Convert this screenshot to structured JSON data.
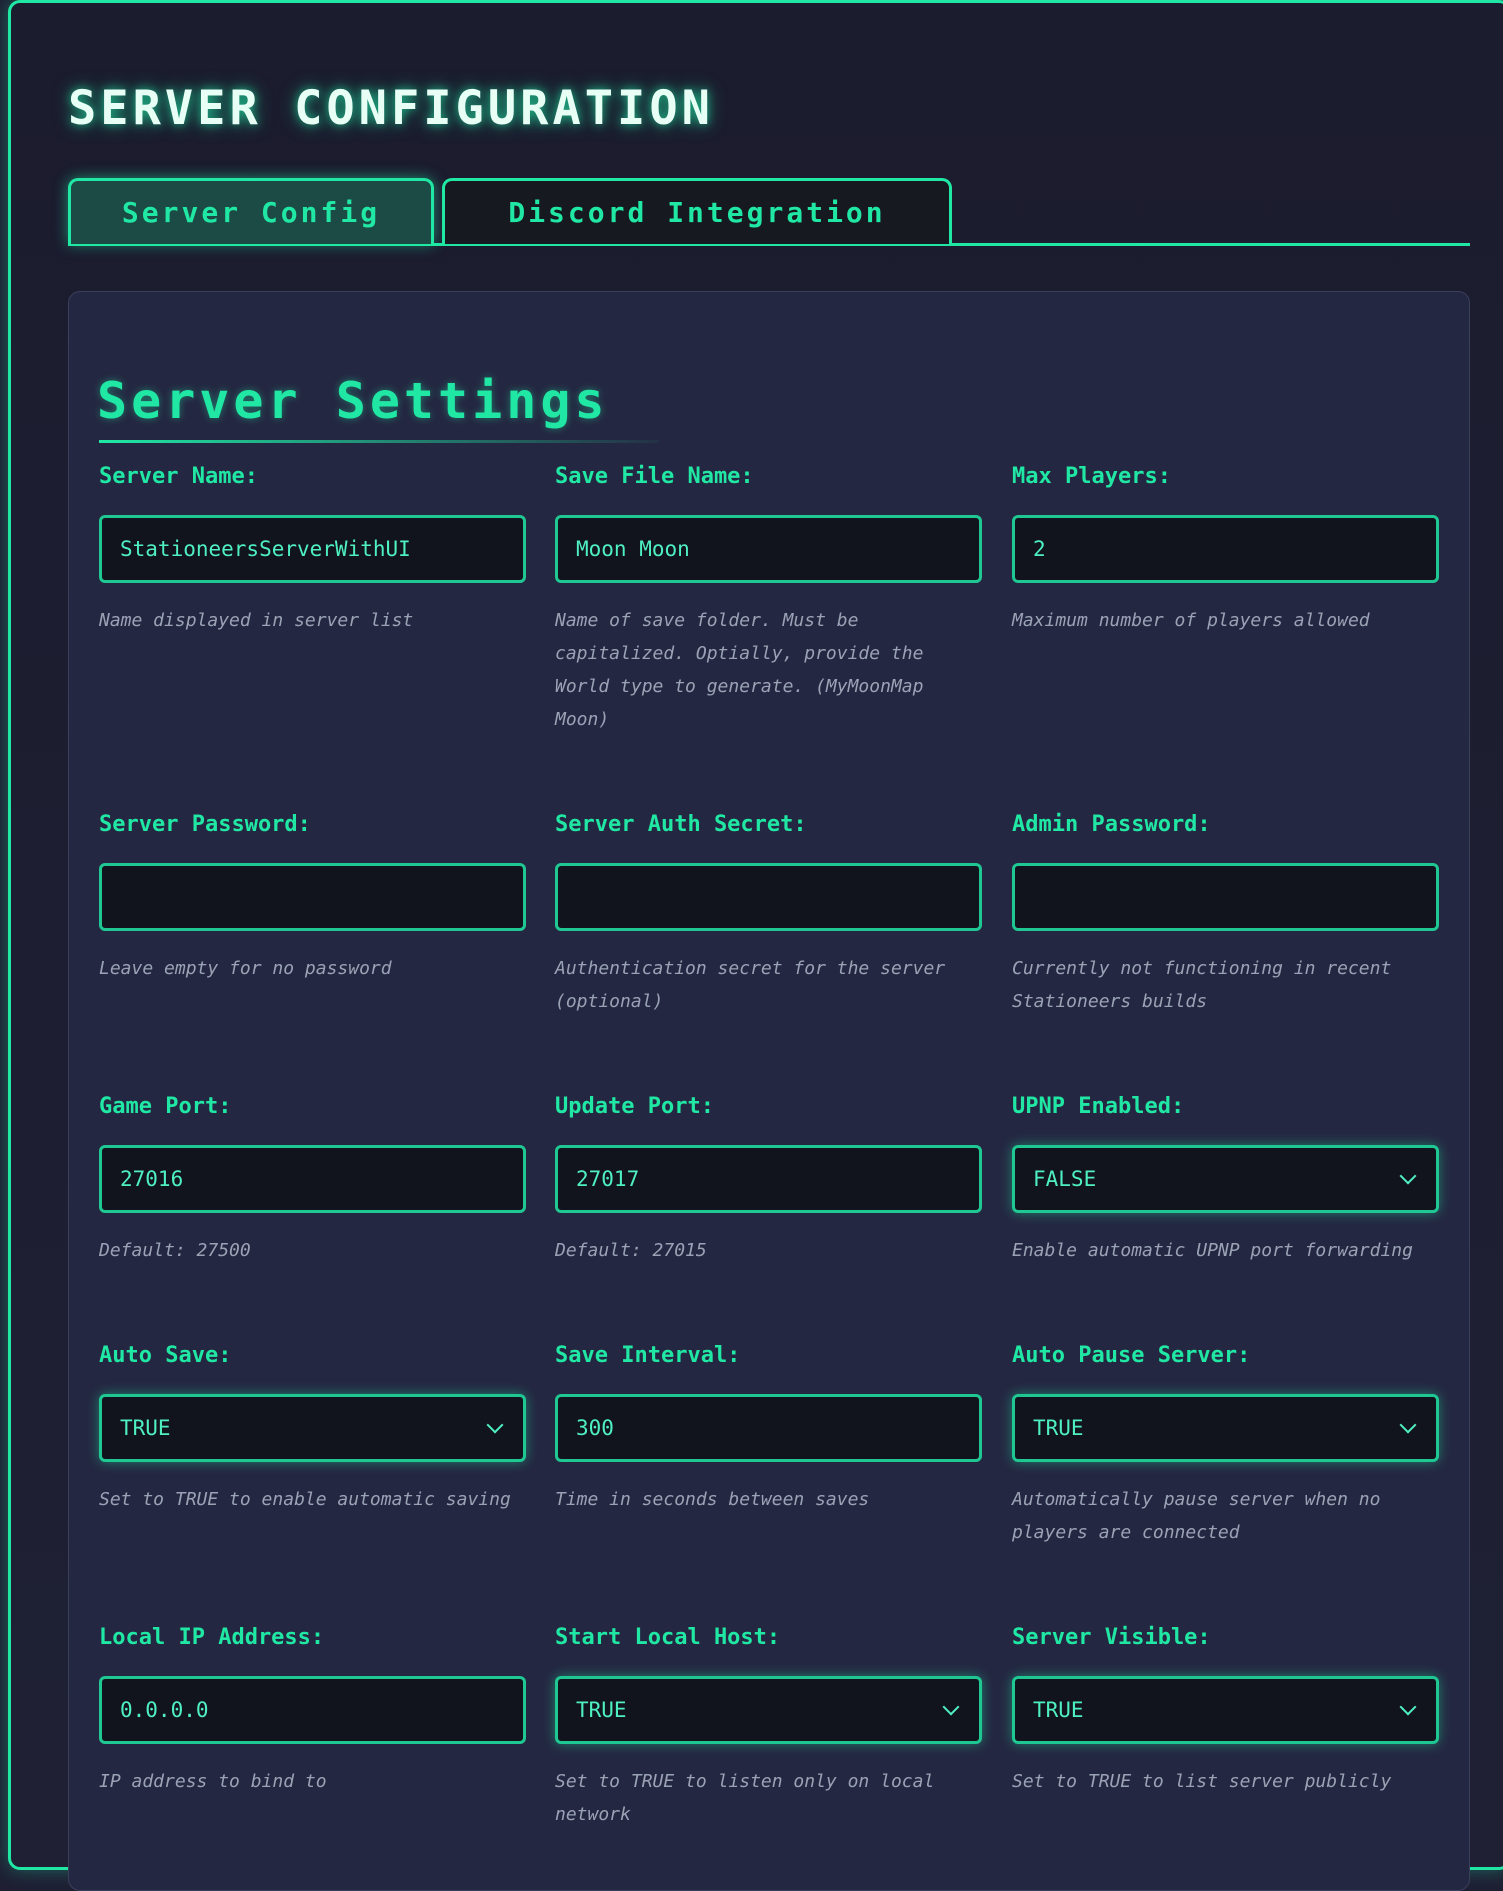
{
  "page_title": "SERVER CONFIGURATION",
  "tabs": [
    {
      "label": "Server Config",
      "active": true
    },
    {
      "label": "Discord Integration",
      "active": false
    }
  ],
  "section_title": "Server Settings",
  "accent_color": "#20e8a4",
  "fields": {
    "server_name": {
      "label": "Server Name:",
      "value": "StationeersServerWithUI",
      "help": "Name displayed in server list"
    },
    "save_file_name": {
      "label": "Save File Name:",
      "value": "Moon Moon",
      "help": "Name of save folder. Must be capitalized. Optially, provide the World type to generate. (MyMoonMap Moon)"
    },
    "max_players": {
      "label": "Max Players:",
      "value": "2",
      "help": "Maximum number of players allowed"
    },
    "server_password": {
      "label": "Server Password:",
      "value": "",
      "help": "Leave empty for no password"
    },
    "server_auth_secret": {
      "label": "Server Auth Secret:",
      "value": "",
      "help": "Authentication secret for the server (optional)"
    },
    "admin_password": {
      "label": "Admin Password:",
      "value": "",
      "help": "Currently not functioning in recent Stationeers builds"
    },
    "game_port": {
      "label": "Game Port:",
      "value": "27016",
      "help": "Default: 27500"
    },
    "update_port": {
      "label": "Update Port:",
      "value": "27017",
      "help": "Default: 27015"
    },
    "upnp_enabled": {
      "label": "UPNP Enabled:",
      "value": "FALSE",
      "help": "Enable automatic UPNP port forwarding"
    },
    "auto_save": {
      "label": "Auto Save:",
      "value": "TRUE",
      "help": "Set to TRUE to enable automatic saving"
    },
    "save_interval": {
      "label": "Save Interval:",
      "value": "300",
      "help": "Time in seconds between saves"
    },
    "auto_pause_server": {
      "label": "Auto Pause Server:",
      "value": "TRUE",
      "help": "Automatically pause server when no players are connected"
    },
    "local_ip_address": {
      "label": "Local IP Address:",
      "value": "0.0.0.0",
      "help": "IP address to bind to"
    },
    "start_local_host": {
      "label": "Start Local Host:",
      "value": "TRUE",
      "help": "Set to TRUE to listen only on local network"
    },
    "server_visible": {
      "label": "Server Visible:",
      "value": "TRUE",
      "help": "Set to TRUE to list server publicly"
    }
  }
}
